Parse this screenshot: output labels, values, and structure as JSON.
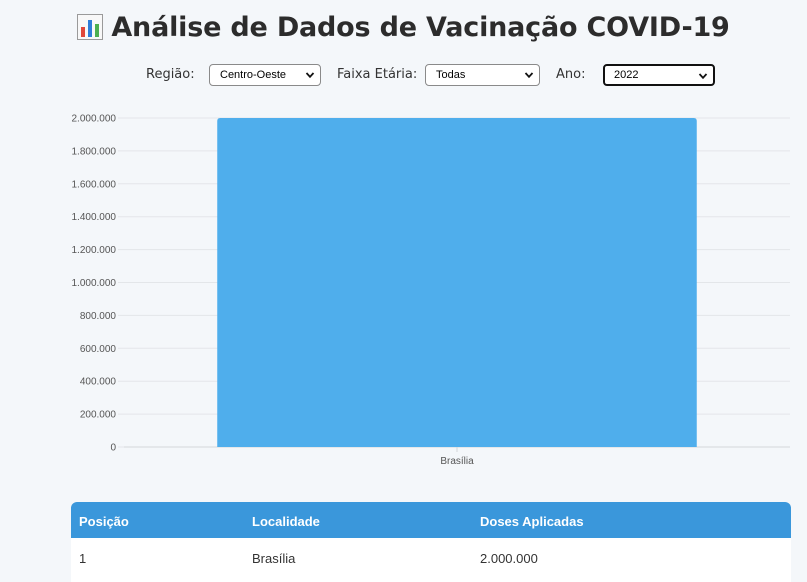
{
  "page": {
    "title": "Análise de Dados de Vacinação COVID-19",
    "title_icon": "bar-chart-icon"
  },
  "filters": {
    "regiao": {
      "label": "Região:",
      "selected": "Centro-Oeste"
    },
    "faixa": {
      "label": "Faixa Etária:",
      "selected": "Todas"
    },
    "ano": {
      "label": "Ano:",
      "selected": "2022"
    }
  },
  "chart_data": {
    "type": "bar",
    "categories": [
      "Brasília"
    ],
    "values": [
      2000000
    ],
    "ylim": [
      0,
      2000000
    ],
    "yticks": [
      0,
      200000,
      400000,
      600000,
      800000,
      1000000,
      1200000,
      1400000,
      1600000,
      1800000,
      2000000
    ],
    "ytick_labels": [
      "0",
      "200.000",
      "400.000",
      "600.000",
      "800.000",
      "1.000.000",
      "1.200.000",
      "1.400.000",
      "1.600.000",
      "1.800.000",
      "2.000.000"
    ],
    "grid": true,
    "bar_color": "#4faeec"
  },
  "table": {
    "headers": [
      "Posição",
      "Localidade",
      "Doses Aplicadas"
    ],
    "rows": [
      [
        "1",
        "Brasília",
        "2.000.000"
      ]
    ],
    "header_color": "#3a97db"
  }
}
